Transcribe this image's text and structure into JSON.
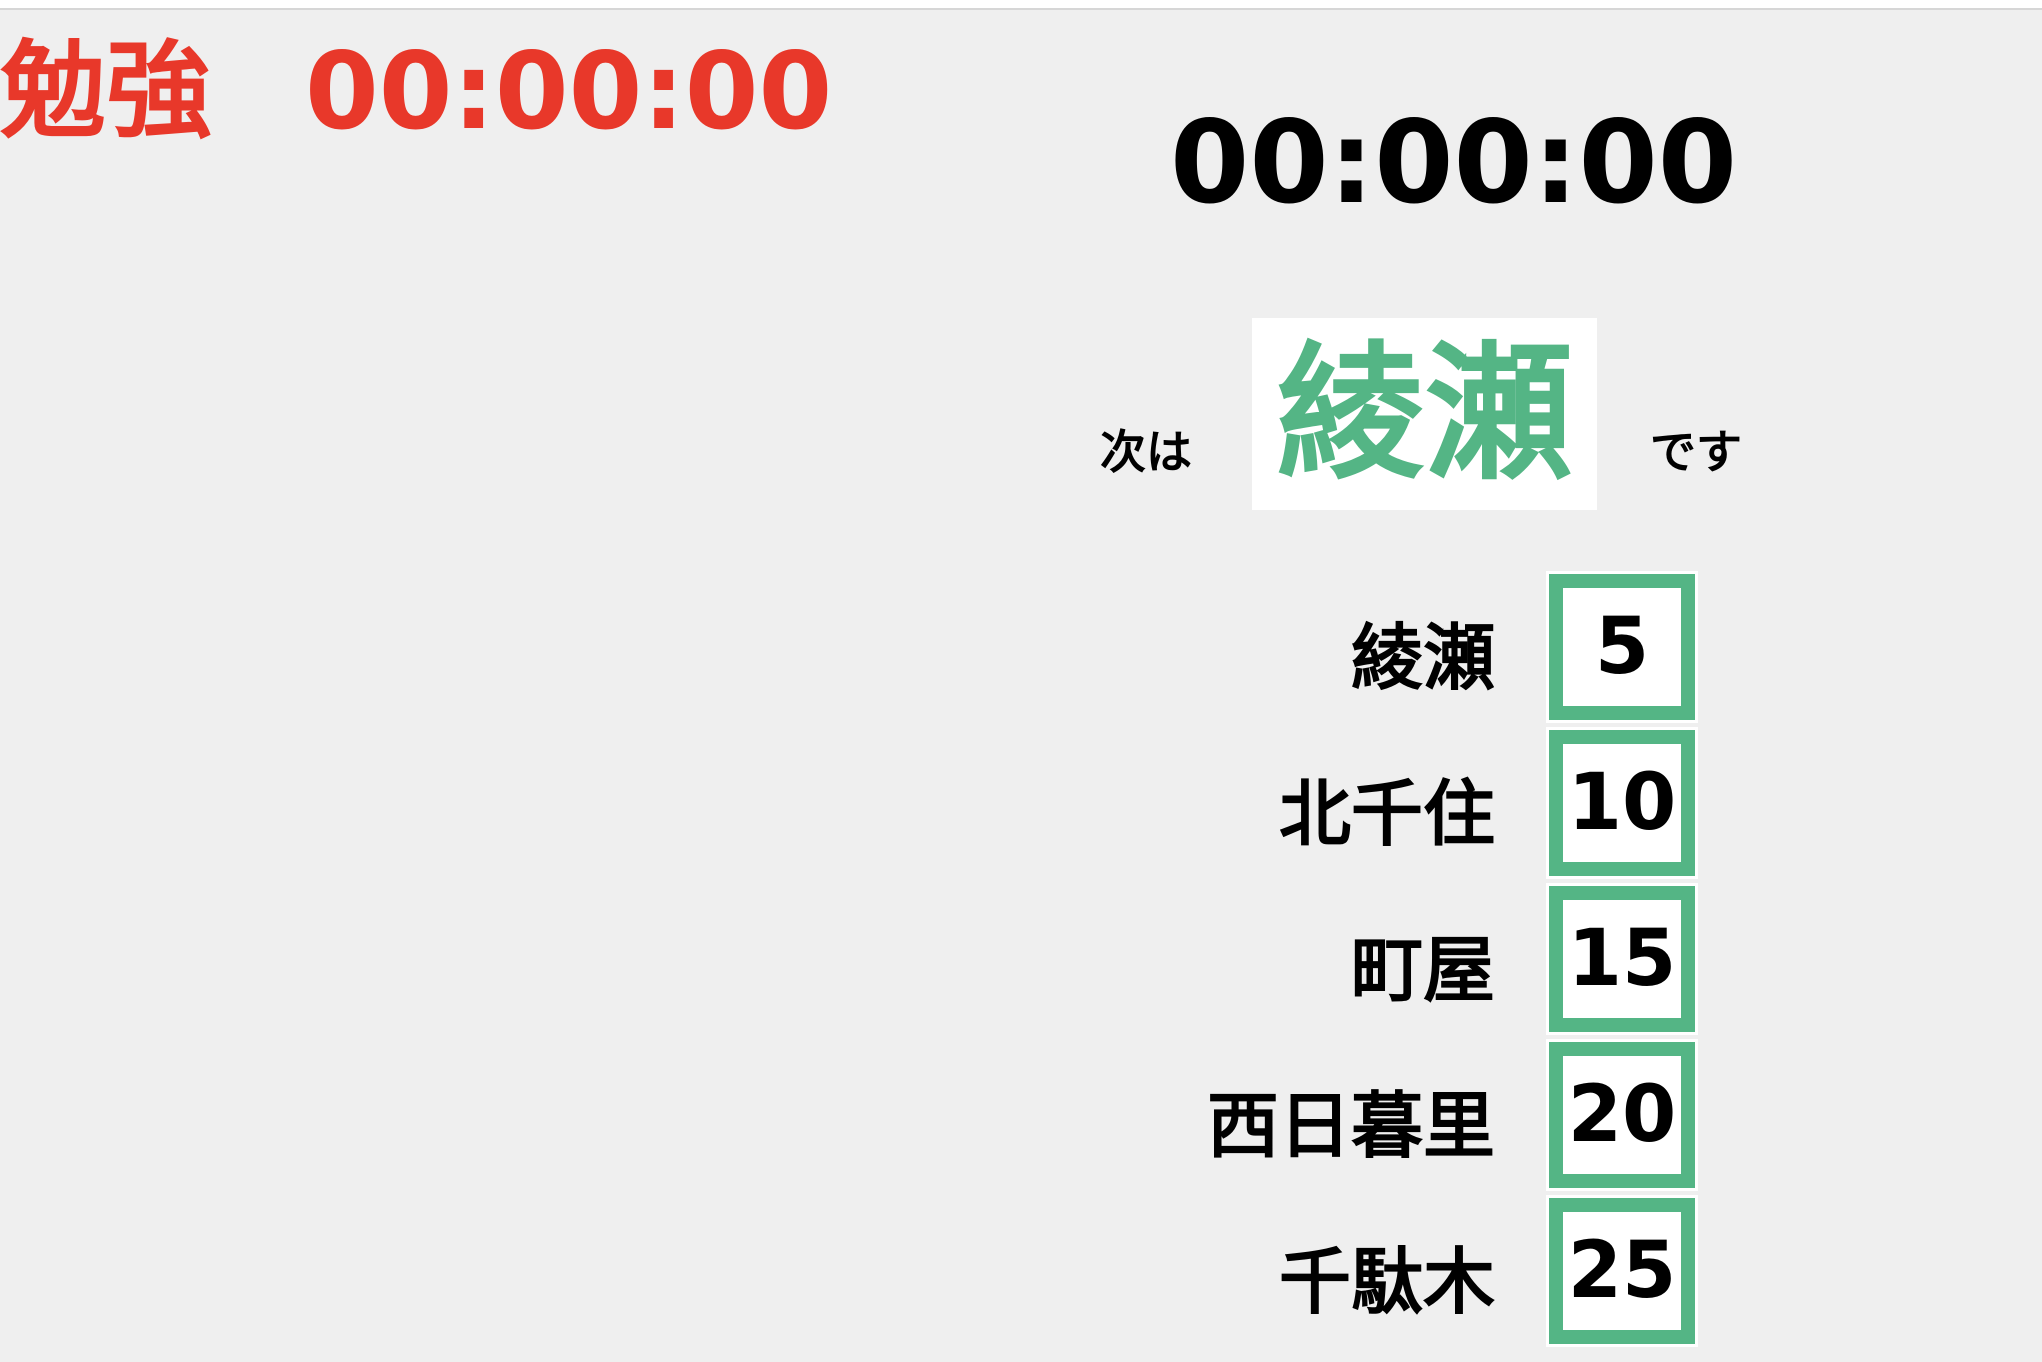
{
  "header": {
    "mode_label": "勉強",
    "mode_timer": "00:00:00"
  },
  "main_timer": "00:00:00",
  "next": {
    "prefix": "次は",
    "station": "綾瀬",
    "suffix": "です"
  },
  "schedule": [
    {
      "station": "綾瀬",
      "minutes": "5"
    },
    {
      "station": "北千住",
      "minutes": "10"
    },
    {
      "station": "町屋",
      "minutes": "15"
    },
    {
      "station": "西日暮里",
      "minutes": "20"
    },
    {
      "station": "千駄木",
      "minutes": "25"
    }
  ],
  "colors": {
    "accent_red": "#e8382a",
    "accent_green": "#54b585",
    "background": "#efefef"
  }
}
